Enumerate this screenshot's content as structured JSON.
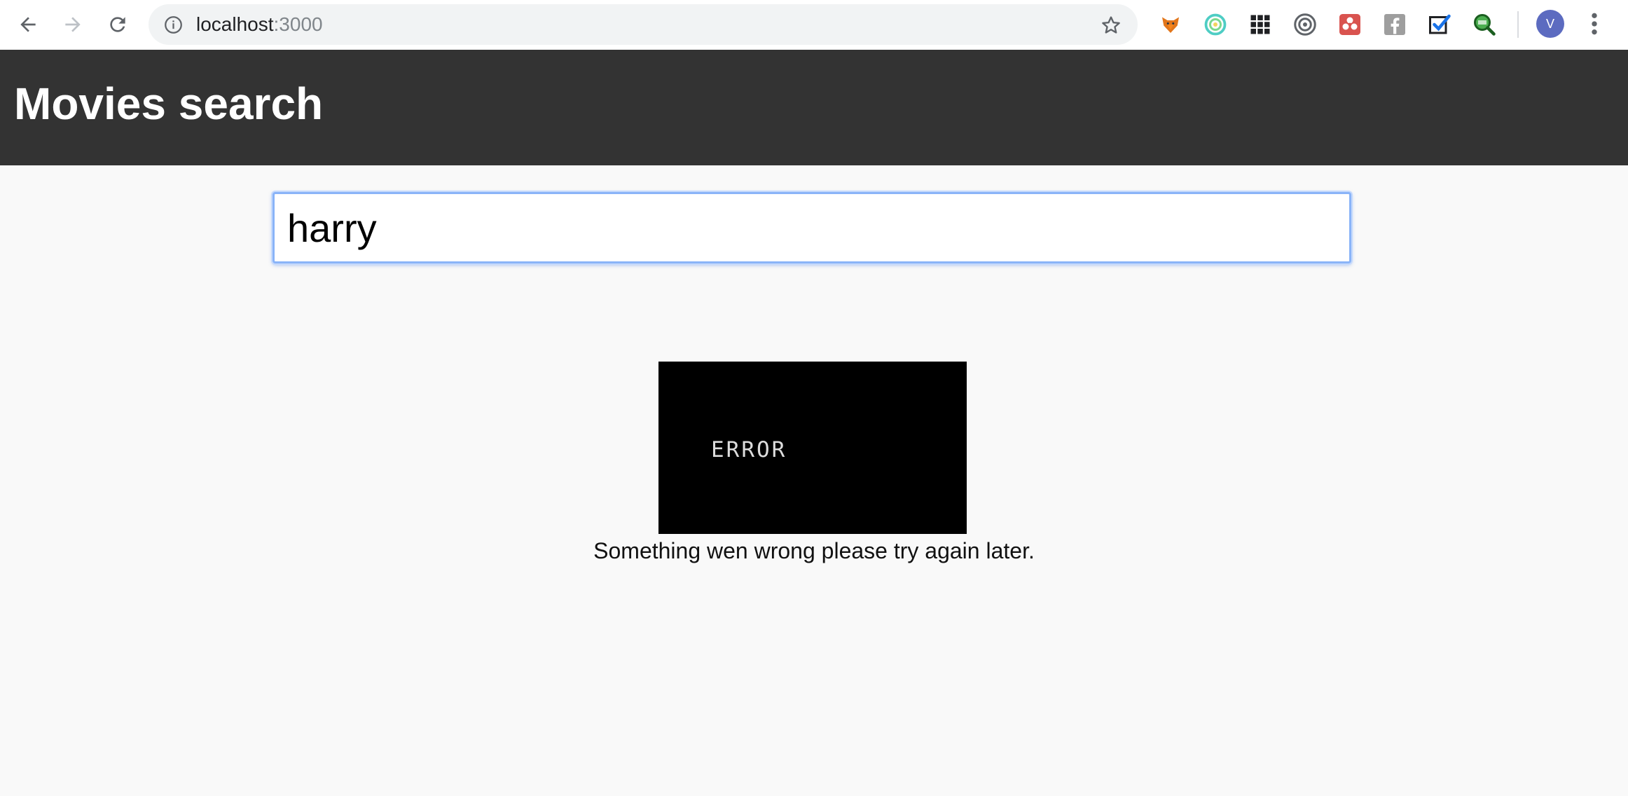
{
  "browser": {
    "url_host": "localhost",
    "url_port": ":3000",
    "avatar_letter": "V",
    "extensions": [
      "fox-extension-icon",
      "target-ring-extension-icon",
      "grid-extension-icon",
      "circle-target-extension-icon",
      "red-flower-extension-icon",
      "facebook-extension-icon",
      "checkbox-extension-icon",
      "green-magnifier-extension-icon"
    ]
  },
  "header": {
    "title": "Movies search"
  },
  "search": {
    "value": "harry"
  },
  "error": {
    "image_text": "ERROR",
    "message": "Something wen wrong please try again later."
  },
  "colors": {
    "header_bg": "#333333",
    "page_bg": "#f9f9f9",
    "focus_ring": "#8ab4f8",
    "avatar": "#5c6bc0"
  }
}
